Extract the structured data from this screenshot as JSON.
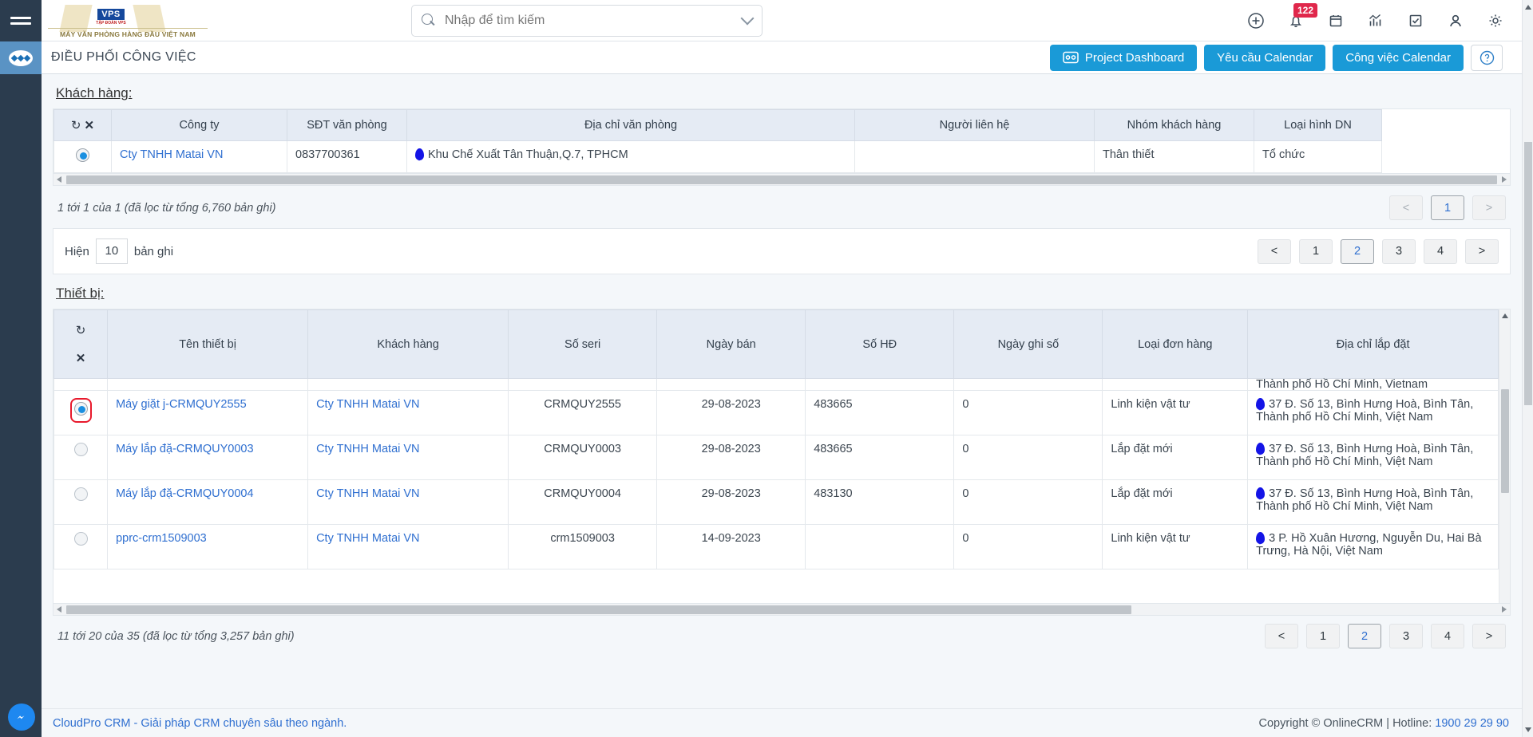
{
  "brand": {
    "seal_text": "VPS",
    "seal_sub": "TẬP ĐOÀN VPS",
    "tagline": "MÁY VĂN PHÒNG HÀNG ĐẦU VIỆT NAM"
  },
  "search": {
    "placeholder": "Nhập để tìm kiếm",
    "value": "",
    "icon": "search-icon",
    "dropdown_icon": "chevron-down-icon"
  },
  "topbar_icons": [
    {
      "name": "plus-circle-icon",
      "badge": ""
    },
    {
      "name": "bell-icon",
      "badge": "122"
    },
    {
      "name": "calendar-icon",
      "badge": ""
    },
    {
      "name": "chart-icon",
      "badge": ""
    },
    {
      "name": "checkbox-task-icon",
      "badge": ""
    },
    {
      "name": "user-icon",
      "badge": ""
    },
    {
      "name": "gear-icon",
      "badge": ""
    }
  ],
  "page": {
    "title": "ĐIỀU PHỐI CÔNG VIỆC",
    "buttons": [
      {
        "label": "Project Dashboard",
        "icon": "dashboard-icon"
      },
      {
        "label": "Yêu cầu Calendar",
        "icon": ""
      },
      {
        "label": "Công việc Calendar",
        "icon": ""
      }
    ],
    "help_label": "?",
    "accent": "#1a9ad7"
  },
  "customer_section": {
    "label": "Khách hàng:",
    "headers": [
      "",
      "Công ty",
      "SĐT văn phòng",
      "Địa chỉ văn phòng",
      "Người liên hệ",
      "Nhóm khách hàng",
      "Loại hình DN"
    ],
    "header_icons": [
      "refresh-icon",
      "clear-icon"
    ],
    "rows": [
      {
        "selected": true,
        "company": "Cty TNHH Matai VN",
        "phone": "0837700361",
        "address": "Khu Chế Xuất Tân Thuận,Q.7, TPHCM",
        "contact": "",
        "group": "Thân thiết",
        "type": "Tổ chức"
      }
    ],
    "info": "1 tới 1 của 1 (đã lọc từ tổng 6,760 bản ghi)",
    "pager": [
      {
        "label": "<",
        "state": "dim"
      },
      {
        "label": "1",
        "state": "cur"
      },
      {
        "label": ">",
        "state": "dim"
      }
    ]
  },
  "length_bar": {
    "prefix": "Hiện",
    "value": "10",
    "suffix": "bản ghi",
    "pager": [
      {
        "label": "<",
        "state": "plain"
      },
      {
        "label": "1",
        "state": "plain"
      },
      {
        "label": "2",
        "state": "cur"
      },
      {
        "label": "3",
        "state": "plain"
      },
      {
        "label": "4",
        "state": "plain"
      },
      {
        "label": ">",
        "state": "plain"
      }
    ]
  },
  "device_section": {
    "label": "Thiết bị:",
    "headers": [
      "",
      "Tên thiết bị",
      "Khách hàng",
      "Số seri",
      "Ngày bán",
      "Số HĐ",
      "Ngày ghi số",
      "Loại đơn hàng",
      "Địa chỉ lắp đặt"
    ],
    "header_icons": [
      "refresh-icon",
      "clear-icon"
    ],
    "clipped_top_text": "Thành phố Hồ Chí Minh, Vietnam",
    "rows": [
      {
        "selected": true,
        "highlighted": true,
        "name": "Máy giặt j-CRMQUY2555",
        "customer": "Cty TNHH Matai VN",
        "serial": "CRMQUY2555",
        "sale_date": "29-08-2023",
        "contract": "483665",
        "record_date": "0",
        "order_type": "Linh kiện vật tư",
        "address": "37 Đ. Số 13, Bình Hưng Hoà, Bình Tân, Thành phố Hồ Chí Minh, Việt Nam"
      },
      {
        "selected": false,
        "highlighted": false,
        "name": "Máy lắp đặ-CRMQUY0003",
        "customer": "Cty TNHH Matai VN",
        "serial": "CRMQUY0003",
        "sale_date": "29-08-2023",
        "contract": "483665",
        "record_date": "0",
        "order_type": "Lắp đặt mới",
        "address": "37 Đ. Số 13, Bình Hưng Hoà, Bình Tân, Thành phố Hồ Chí Minh, Việt Nam"
      },
      {
        "selected": false,
        "highlighted": false,
        "name": "Máy lắp đặ-CRMQUY0004",
        "customer": "Cty TNHH Matai VN",
        "serial": "CRMQUY0004",
        "sale_date": "29-08-2023",
        "contract": "483130",
        "record_date": "0",
        "order_type": "Lắp đặt mới",
        "address": "37 Đ. Số 13, Bình Hưng Hoà, Bình Tân, Thành phố Hồ Chí Minh, Việt Nam"
      },
      {
        "selected": false,
        "highlighted": false,
        "name": "pprc-crm1509003",
        "customer": "Cty TNHH Matai VN",
        "serial": "crm1509003",
        "sale_date": "14-09-2023",
        "contract": "",
        "record_date": "0",
        "order_type": "Linh kiện vật tư",
        "address": "3 P. Hồ Xuân Hương, Nguyễn Du, Hai Bà Trưng, Hà Nội, Việt Nam"
      }
    ],
    "info": "11 tới 20 của 35 (đã lọc từ tổng 3,257 bản ghi)",
    "pager": [
      {
        "label": "<",
        "state": "plain"
      },
      {
        "label": "1",
        "state": "plain"
      },
      {
        "label": "2",
        "state": "cur"
      },
      {
        "label": "3",
        "state": "plain"
      },
      {
        "label": "4",
        "state": "plain"
      },
      {
        "label": ">",
        "state": "plain"
      }
    ]
  },
  "footer": {
    "left": "CloudPro CRM - Giải pháp CRM chuyên sâu theo ngành.",
    "copyright": "Copyright © OnlineCRM | Hotline: ",
    "hotline": "1900 29 29 90"
  }
}
